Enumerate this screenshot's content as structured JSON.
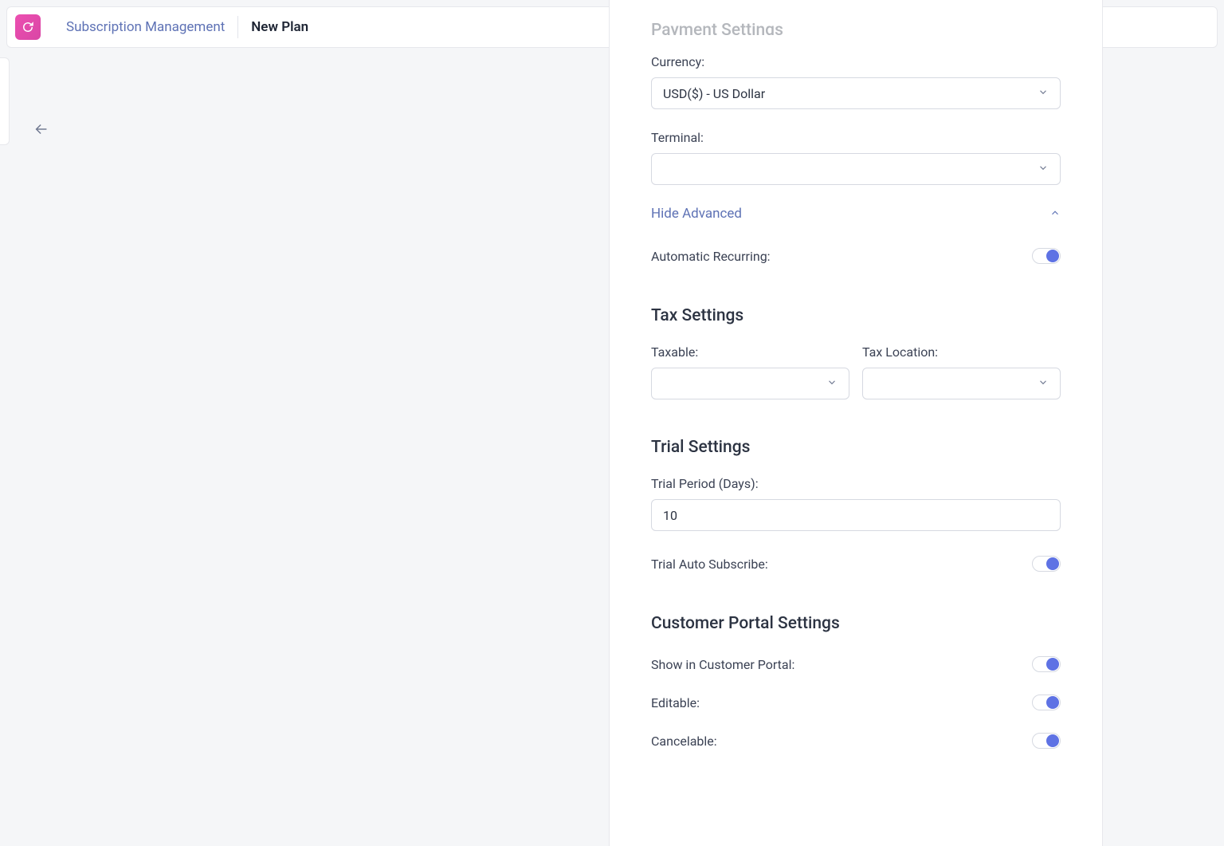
{
  "breadcrumb": {
    "app_label": "Subscription Management",
    "current": "New Plan"
  },
  "payment_settings": {
    "heading_cutoff": "Payment Settings",
    "currency_label": "Currency:",
    "currency_value": "USD($) - US Dollar",
    "terminal_label": "Terminal:",
    "terminal_value": "",
    "hide_advanced_label": "Hide Advanced",
    "automatic_recurring_label": "Automatic Recurring:",
    "automatic_recurring_on": true
  },
  "tax_settings": {
    "heading": "Tax Settings",
    "taxable_label": "Taxable:",
    "taxable_value": "",
    "location_label": "Tax Location:",
    "location_value": ""
  },
  "trial_settings": {
    "heading": "Trial Settings",
    "period_label": "Trial Period (Days):",
    "period_value": "10",
    "auto_subscribe_label": "Trial Auto Subscribe:",
    "auto_subscribe_on": true
  },
  "portal_settings": {
    "heading": "Customer Portal Settings",
    "show_label": "Show in Customer Portal:",
    "show_on": true,
    "editable_label": "Editable:",
    "editable_on": true,
    "cancelable_label": "Cancelable:",
    "cancelable_on": true
  }
}
